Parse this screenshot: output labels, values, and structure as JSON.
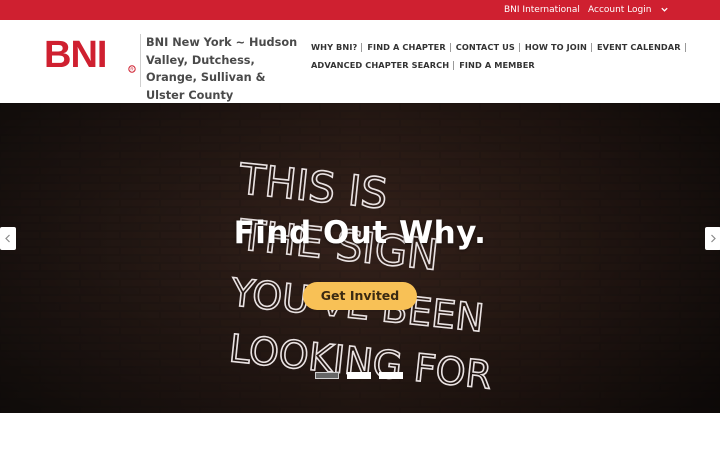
{
  "topbar": {
    "bni_international": "BNI International",
    "account_login": "Account Login"
  },
  "header": {
    "logo_text": "BNI",
    "chapter_name": "BNI New York ~ Hudson Valley, Dutchess, Orange, Sullivan & Ulster County"
  },
  "nav": {
    "row1": [
      "WHY BNI?",
      "FIND A CHAPTER",
      "CONTACT US",
      "HOW TO JOIN",
      "EVENT CALENDAR"
    ],
    "row2": [
      "ADVANCED CHAPTER SEARCH",
      "FIND A MEMBER"
    ]
  },
  "hero": {
    "headline": "Find Out Why.",
    "cta_label": "Get Invited",
    "neon_lines": [
      "THIS IS",
      "THE SIGN",
      "YOU'VE BEEN",
      "LOOKING FOR"
    ],
    "slides_count": 3,
    "active_slide": 1
  },
  "colors": {
    "brand_red": "#cf2030",
    "cta_yellow": "#f8c156"
  }
}
